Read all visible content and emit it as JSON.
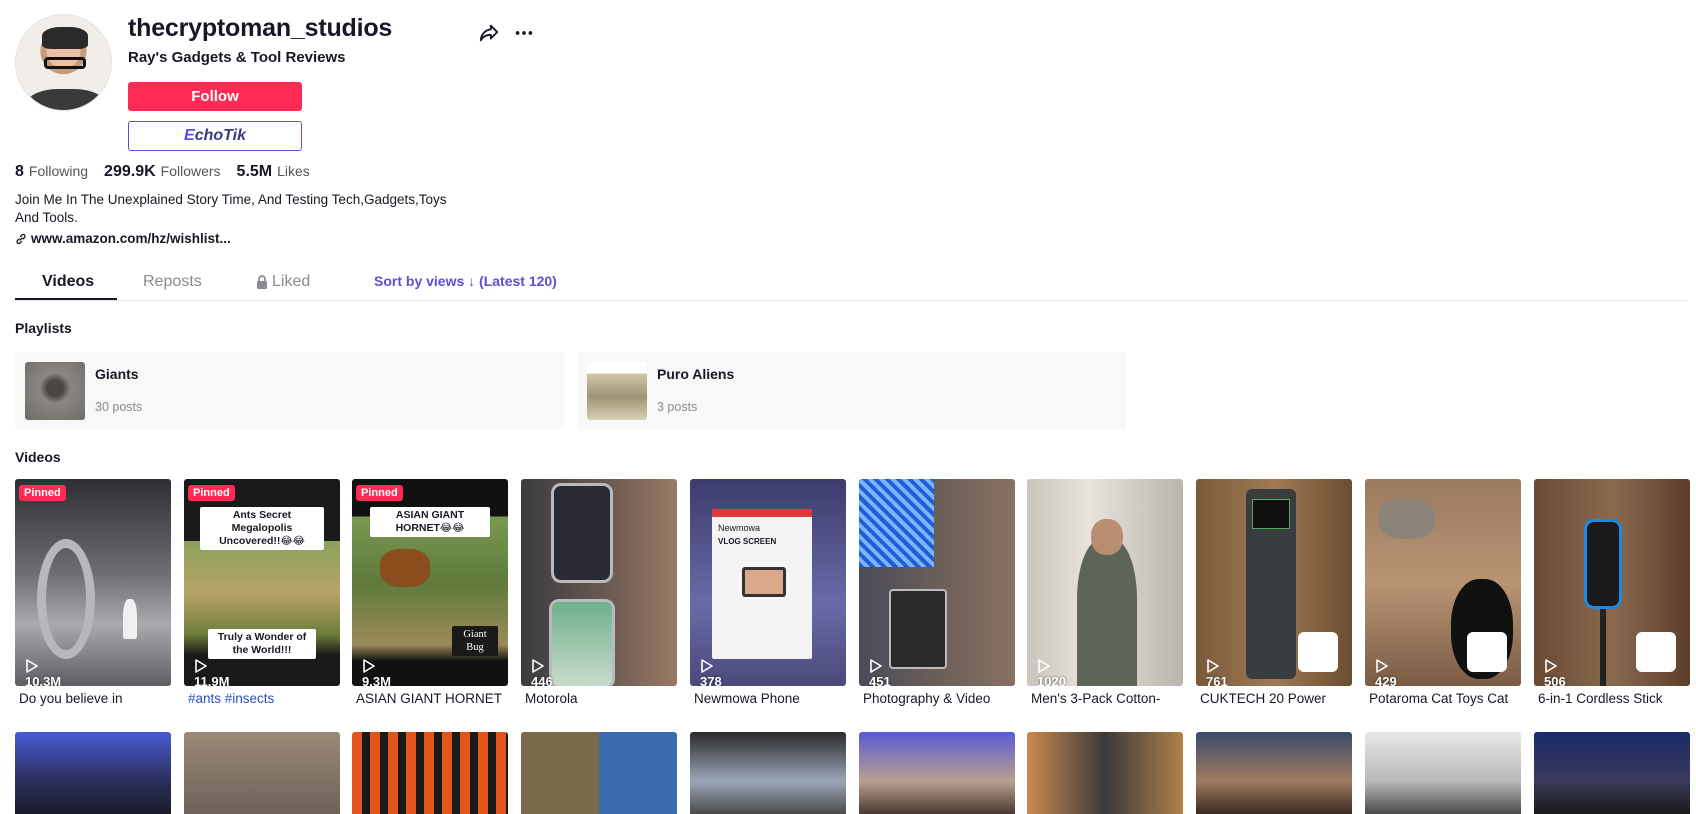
{
  "profile": {
    "username": "thecryptoman_studios",
    "nickname": "Ray's Gadgets & Tool Reviews",
    "follow_label": "Follow",
    "echotik_label_e": "E",
    "echotik_label_rest": "choTik",
    "stats": [
      {
        "value": "8",
        "label": "Following"
      },
      {
        "value": "299.9K",
        "label": "Followers"
      },
      {
        "value": "5.5M",
        "label": "Likes"
      }
    ],
    "bio": "Join Me In The Unexplained Story Time, And Testing Tech,Gadgets,Toys And Tools.",
    "link": "www.amazon.com/hz/wishlist..."
  },
  "tabs": {
    "videos": "Videos",
    "reposts": "Reposts",
    "liked": "Liked",
    "sort": "Sort by views ↓ (Latest 120)"
  },
  "sections": {
    "playlists": "Playlists",
    "videos": "Videos"
  },
  "playlists": [
    {
      "name": "Giants",
      "count": "30 posts"
    },
    {
      "name": "Puro Aliens",
      "count": "3 posts"
    }
  ],
  "videos": [
    {
      "pinned": "Pinned",
      "views": "10.3M",
      "caption": "Do you believe in"
    },
    {
      "pinned": "Pinned",
      "views": "11.9M",
      "caption": "#ants #insects",
      "overlay_top": "Ants Secret Megalopolis Uncovered!!😂😂",
      "overlay_bottom": "Truly a Wonder of the World!!!"
    },
    {
      "pinned": "Pinned",
      "views": "9.3M",
      "caption": "ASIAN GIANT HORNET",
      "overlay_top": "ASIAN GIANT HORNET😂😂",
      "overlay_bottom": "Giant Bug"
    },
    {
      "views": "446",
      "caption": "Motorola"
    },
    {
      "views": "378",
      "caption": "Newmowa Phone",
      "box_brand": "Newmowa",
      "box_title": "VLOG SCREEN"
    },
    {
      "views": "451",
      "caption": "Photography & Video"
    },
    {
      "views": "1020",
      "caption": "Men's 3-Pack Cotton-"
    },
    {
      "views": "761",
      "caption": "CUKTECH 20 Power"
    },
    {
      "views": "429",
      "caption": "Potaroma Cat Toys Cat"
    },
    {
      "views": "506",
      "caption": "6-in-1 Cordless Stick"
    }
  ],
  "colors": {
    "accent": "#fe2c55",
    "echotik": "#5b4fd9",
    "link_blue": "#2b4fb8"
  },
  "icons": [
    "share-icon",
    "more-icon",
    "link-icon",
    "lock-icon",
    "play-icon"
  ]
}
